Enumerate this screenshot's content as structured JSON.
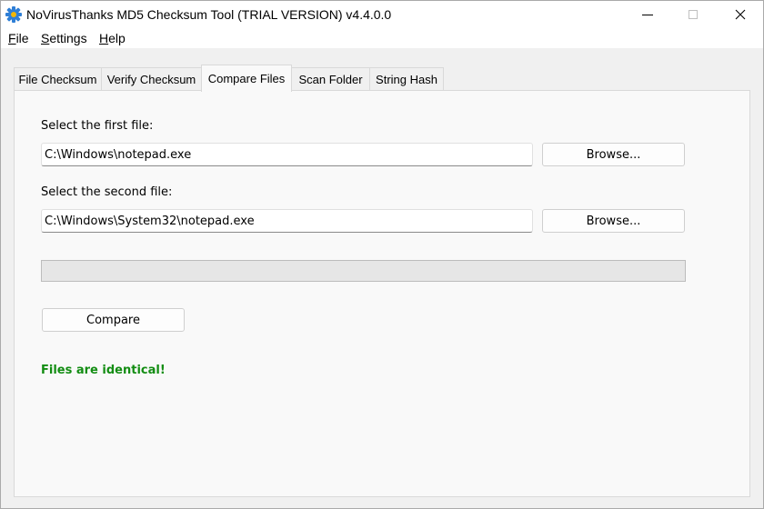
{
  "window": {
    "title": "NoVirusThanks MD5 Checksum Tool (TRIAL VERSION) v4.4.0.0"
  },
  "menu": [
    {
      "hotkey": "F",
      "rest": "ile"
    },
    {
      "hotkey": "S",
      "rest": "ettings"
    },
    {
      "hotkey": "H",
      "rest": "elp"
    }
  ],
  "tabs": [
    "File Checksum",
    "Verify Checksum",
    "Compare Files",
    "Scan Folder",
    "String Hash"
  ],
  "active_tab": "Compare Files",
  "compare": {
    "first_label": "Select the first file:",
    "first_value": "C:\\Windows\\notepad.exe",
    "browse_label": "Browse...",
    "second_label": "Select the second file:",
    "second_value": "C:\\Windows\\System32\\notepad.exe",
    "progress": 0,
    "compare_label": "Compare",
    "result": "Files are identical!"
  },
  "colors": {
    "result_green": "#138d13",
    "icon_blue": "#2f7fd6",
    "icon_yellow": "#f2b705"
  },
  "icons": [
    "app-gear-icon",
    "minimize-icon",
    "maximize-icon",
    "close-icon"
  ]
}
